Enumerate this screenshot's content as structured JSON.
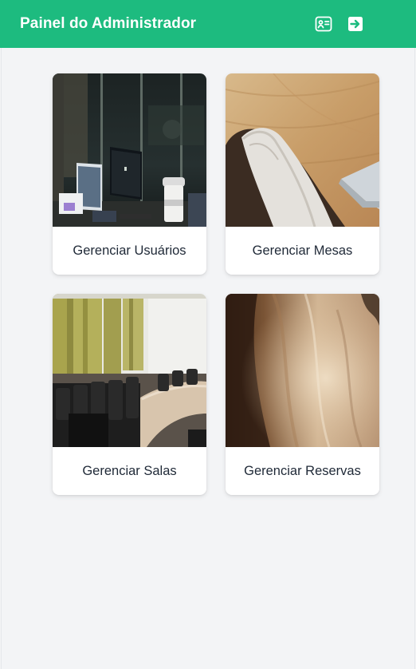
{
  "header": {
    "title": "Painel do Administrador",
    "profile_icon": "id-card-icon",
    "logout_icon": "sign-out-icon",
    "accent_color": "#1dbb7f"
  },
  "cards": [
    {
      "label": "Gerenciar Usuários",
      "image": "office-workspace-photo"
    },
    {
      "label": "Gerenciar Mesas",
      "image": "wooden-desk-photo"
    },
    {
      "label": "Gerenciar Salas",
      "image": "conference-room-photo"
    },
    {
      "label": "Gerenciar Reservas",
      "image": "wood-texture-photo"
    }
  ]
}
